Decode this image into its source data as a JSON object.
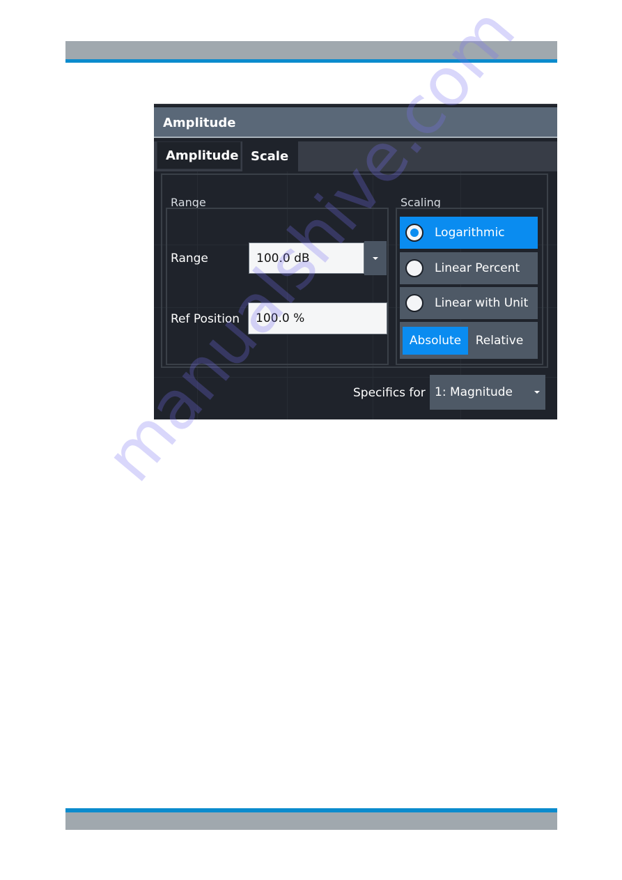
{
  "dialog": {
    "title": "Amplitude",
    "tabs": [
      {
        "label": "Amplitude",
        "active": false
      },
      {
        "label": "Scale",
        "active": true
      }
    ]
  },
  "range_group": {
    "heading": "Range",
    "range": {
      "label": "Range",
      "value": "100.0 dB",
      "icon": "chevron-down-icon"
    },
    "ref_position": {
      "label": "Ref Position",
      "value": "100.0 %"
    }
  },
  "scaling_group": {
    "heading": "Scaling",
    "options": [
      {
        "label": "Logarithmic",
        "selected": true
      },
      {
        "label": "Linear Percent",
        "selected": false
      },
      {
        "label": "Linear with Unit",
        "selected": false
      }
    ],
    "mode_toggle": [
      {
        "label": "Absolute",
        "active": true
      },
      {
        "label": "Relative",
        "active": false
      }
    ]
  },
  "specifics": {
    "label": "Specifics for",
    "value": "1: Magnitude",
    "icon": "chevron-down-icon"
  },
  "colors": {
    "accent_blue": "#0a8cf0",
    "page_band_blue": "#0b8bcd",
    "page_band_gray": "#a0a8ae",
    "dialog_title_bg": "#5a6878",
    "dialog_body_bg": "#1f232b"
  },
  "watermark": "manualshive.com"
}
